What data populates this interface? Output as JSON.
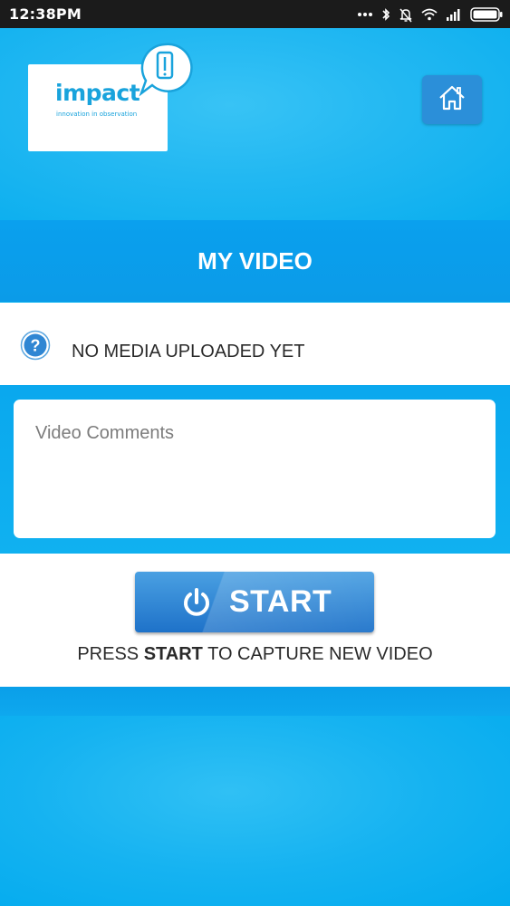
{
  "status_bar": {
    "time": "12:38PM",
    "icons": [
      "more-dots-icon",
      "bluetooth-icon",
      "notifications-off-icon",
      "wifi-icon",
      "signal-icon",
      "battery-icon"
    ]
  },
  "header": {
    "logo_text": "impact",
    "logo_tagline": "innovation in observation",
    "home_icon": "home-icon"
  },
  "page": {
    "title": "MY VIDEO"
  },
  "media": {
    "status": "NO MEDIA UPLOADED YET",
    "icon": "help-icon"
  },
  "comments": {
    "placeholder": "Video Comments",
    "value": ""
  },
  "start": {
    "label": "START",
    "hint_prefix": "PRESS ",
    "hint_bold": "START",
    "hint_suffix": " TO CAPTURE NEW VIDEO"
  },
  "colors": {
    "background": "#00adef",
    "title_band": "#0aa0ee",
    "button": "#2b86d6",
    "logo": "#19a3dc"
  }
}
